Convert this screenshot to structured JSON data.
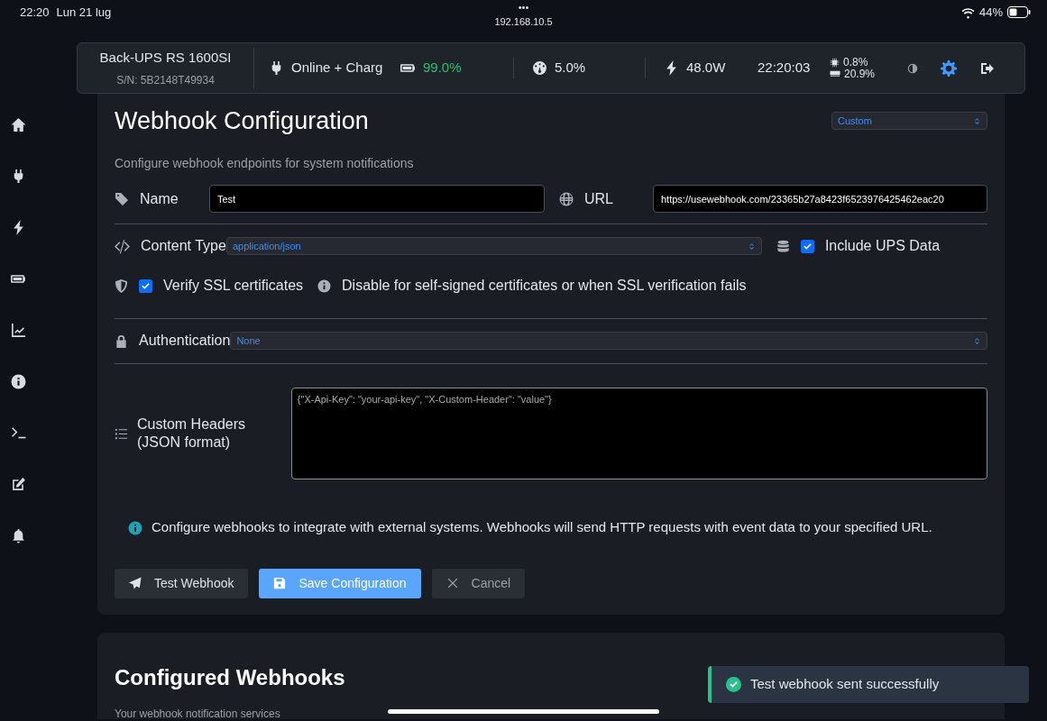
{
  "device_bar": {
    "time": "22:20",
    "date": "Lun 21 lug",
    "dots": "•••",
    "address": "192.168.10.5",
    "battery": "44%"
  },
  "header": {
    "model": "Back-UPS RS 1600SI",
    "serial": "S/N: 5B2148T49934",
    "status": "Online + Charg",
    "charge": "99.0%",
    "load": "5.0%",
    "power": "48.0W",
    "clock": "22:20:03",
    "cpu": "0.8%",
    "memory": "20.9%"
  },
  "form": {
    "title": "Webhook Configuration",
    "preset": "Custom",
    "subtitle": "Configure webhook endpoints for system notifications",
    "name": {
      "label": "Name",
      "value": "Test"
    },
    "url": {
      "label": "URL",
      "value": "https://usewebhook.com/23365b27a8423f6523976425462eac20"
    },
    "content_type": {
      "label": "Content Type",
      "value": "application/json"
    },
    "include_ups": {
      "label": "Include UPS Data",
      "checked": true
    },
    "verify_ssl": {
      "label": "Verify SSL certificates",
      "checked": true
    },
    "ssl_hint": "Disable for self-signed certificates or when SSL verification fails",
    "auth": {
      "label": "Authentication",
      "value": "None"
    },
    "headers": {
      "label": "Custom Headers (JSON format)",
      "placeholder": "{\"X-Api-Key\": \"your-api-key\", \"X-Custom-Header\": \"value\"}"
    },
    "info": "Configure webhooks to integrate with external systems. Webhooks will send HTTP requests with event data to your specified URL.",
    "buttons": [
      {
        "kind": "test",
        "label": "Test Webhook"
      },
      {
        "kind": "save",
        "label": "Save Configuration"
      },
      {
        "kind": "cancel",
        "label": "Cancel"
      }
    ]
  },
  "list": {
    "title": "Configured Webhooks",
    "subtitle": "Your webhook notification services"
  },
  "toast": {
    "message": "Test webhook sent successfully"
  }
}
